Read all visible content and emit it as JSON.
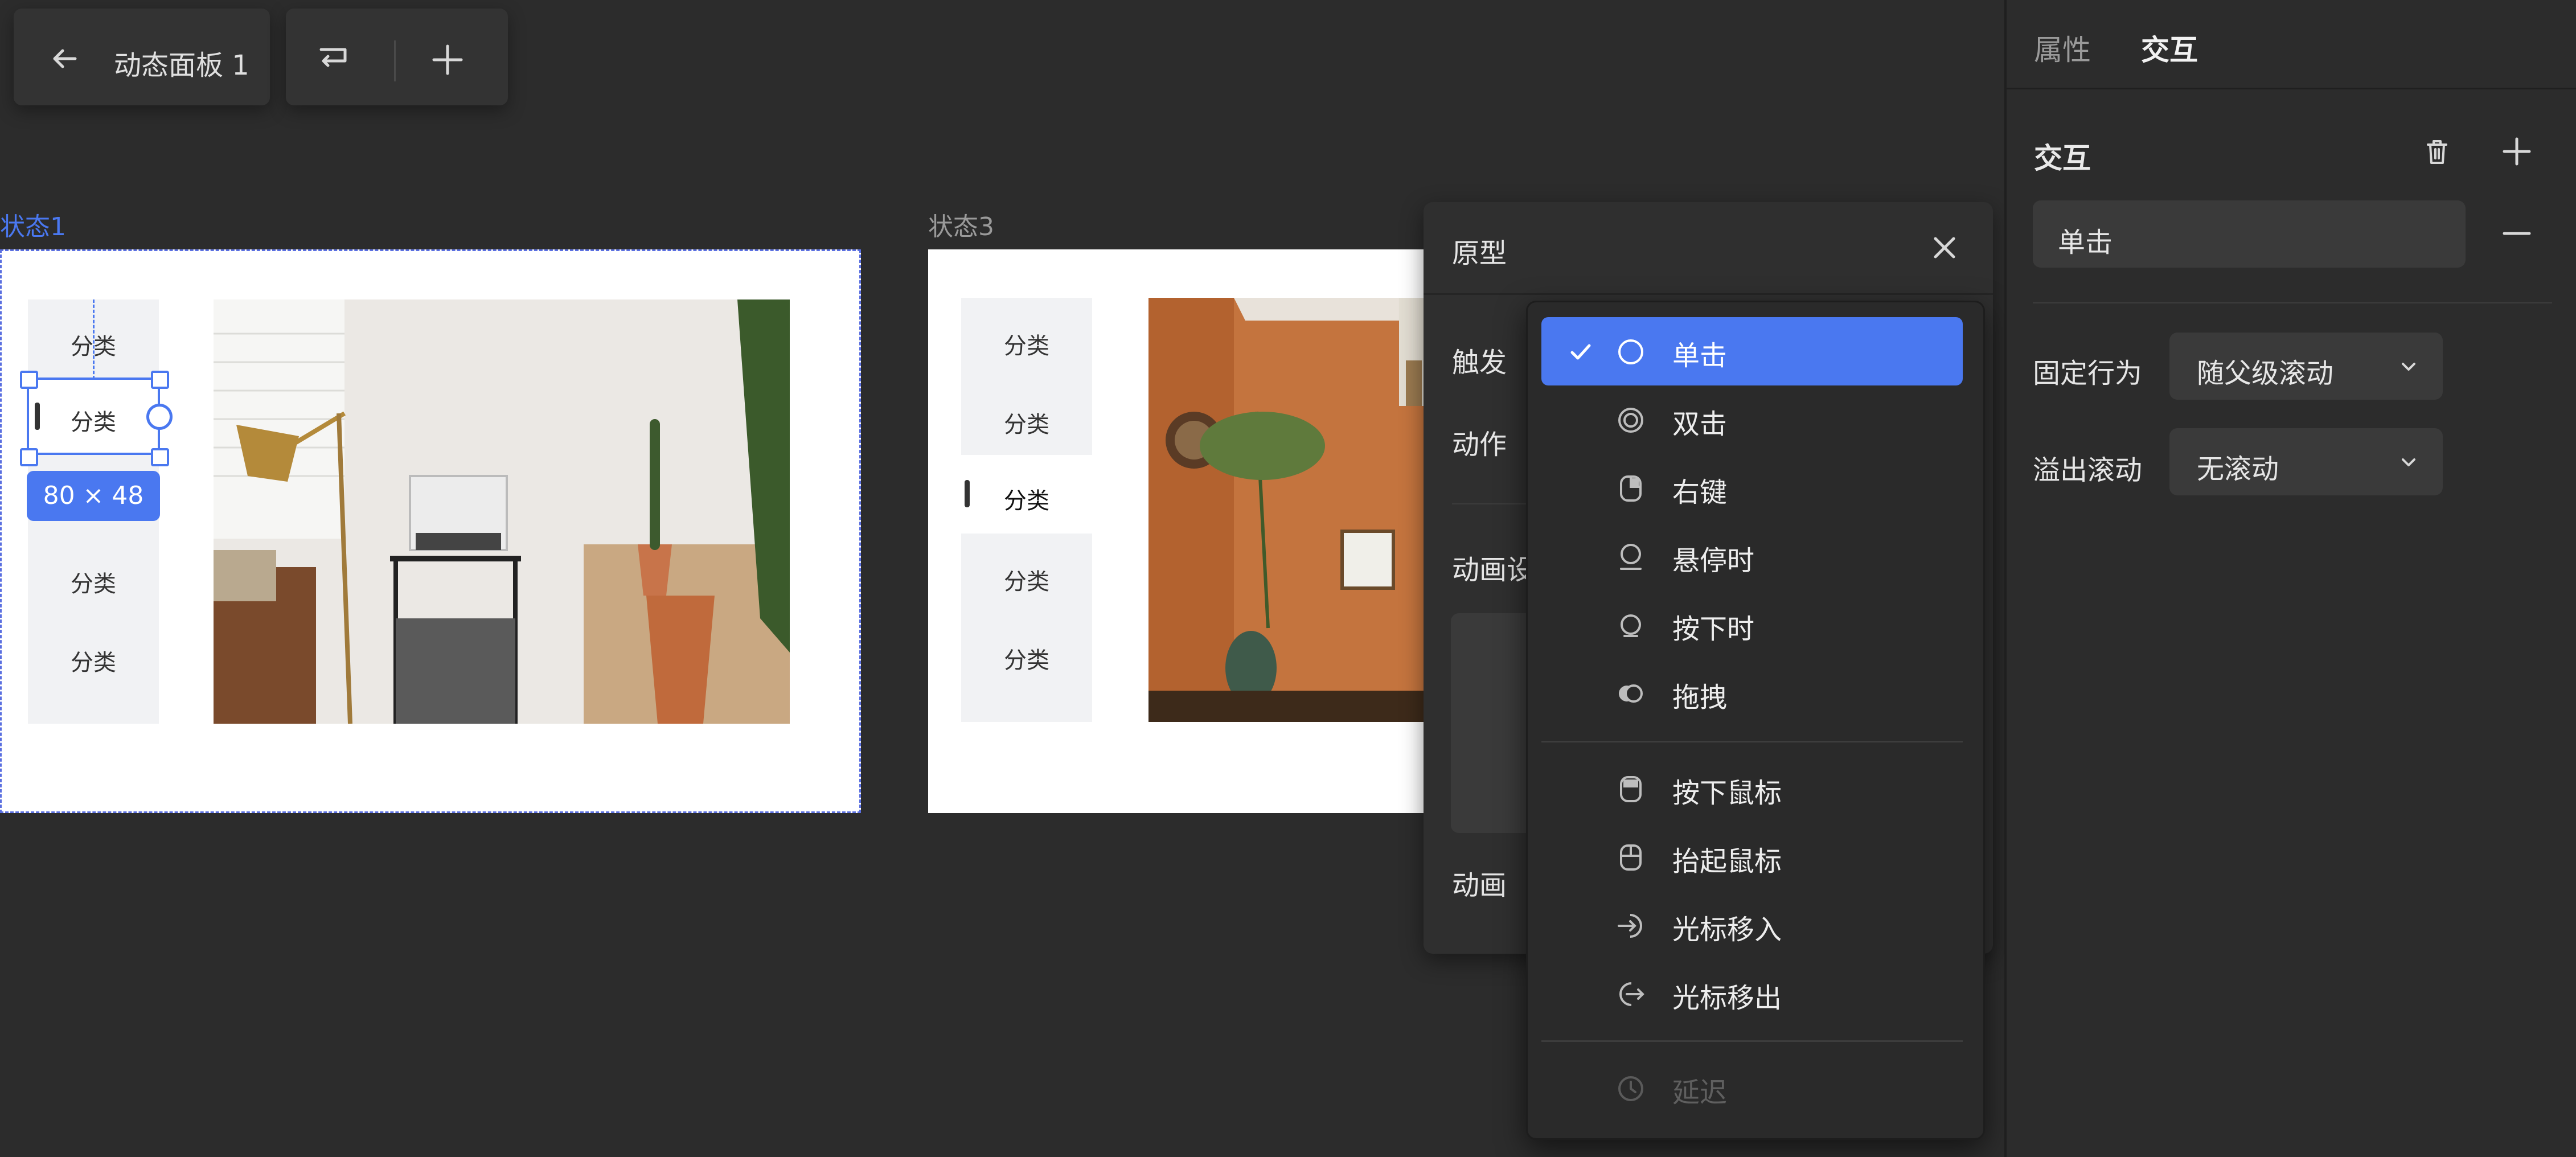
{
  "toolbar": {
    "back_icon": "arrow-left-icon",
    "title": "动态面板 1",
    "flow_icon": "switch-flow-icon",
    "add_icon": "plus-icon"
  },
  "canvas": {
    "state1_label": "状态1",
    "state3_label": "状态3",
    "state1_accent": "#4a78f0",
    "state1": {
      "categories": [
        "分类",
        "分类",
        "分类",
        "分类"
      ],
      "selected_category": "分类",
      "size_badge": "80 × 48"
    },
    "state3": {
      "categories": [
        "分类",
        "分类",
        "分类",
        "分类",
        "分类"
      ]
    }
  },
  "right_panel": {
    "tabs": [
      "属性",
      "交互"
    ],
    "active_tab": "交互",
    "section_title": "交互",
    "trigger_value": "单击",
    "fixed_label": "固定行为",
    "fixed_value": "随父级滚动",
    "overflow_label": "溢出滚动",
    "overflow_value": "无滚动"
  },
  "prototype": {
    "title": "原型",
    "trigger_label": "触发",
    "action_label": "动作",
    "anim_setting_label": "动画设",
    "anim_label": "动画"
  },
  "menu": {
    "items": [
      {
        "label": "单击",
        "icon": "circle-icon",
        "selected": true
      },
      {
        "label": "双击",
        "icon": "double-circle-icon"
      },
      {
        "label": "右键",
        "icon": "mouse-right-icon"
      },
      {
        "label": "悬停时",
        "icon": "hover-icon"
      },
      {
        "label": "按下时",
        "icon": "press-icon"
      },
      {
        "label": "拖拽",
        "icon": "drag-icon"
      },
      {
        "label": "按下鼠标",
        "icon": "mouse-down-icon"
      },
      {
        "label": "抬起鼠标",
        "icon": "mouse-up-icon"
      },
      {
        "label": "光标移入",
        "icon": "cursor-enter-icon"
      },
      {
        "label": "光标移出",
        "icon": "cursor-exit-icon"
      },
      {
        "label": "延迟",
        "icon": "clock-icon",
        "disabled": true
      }
    ]
  }
}
